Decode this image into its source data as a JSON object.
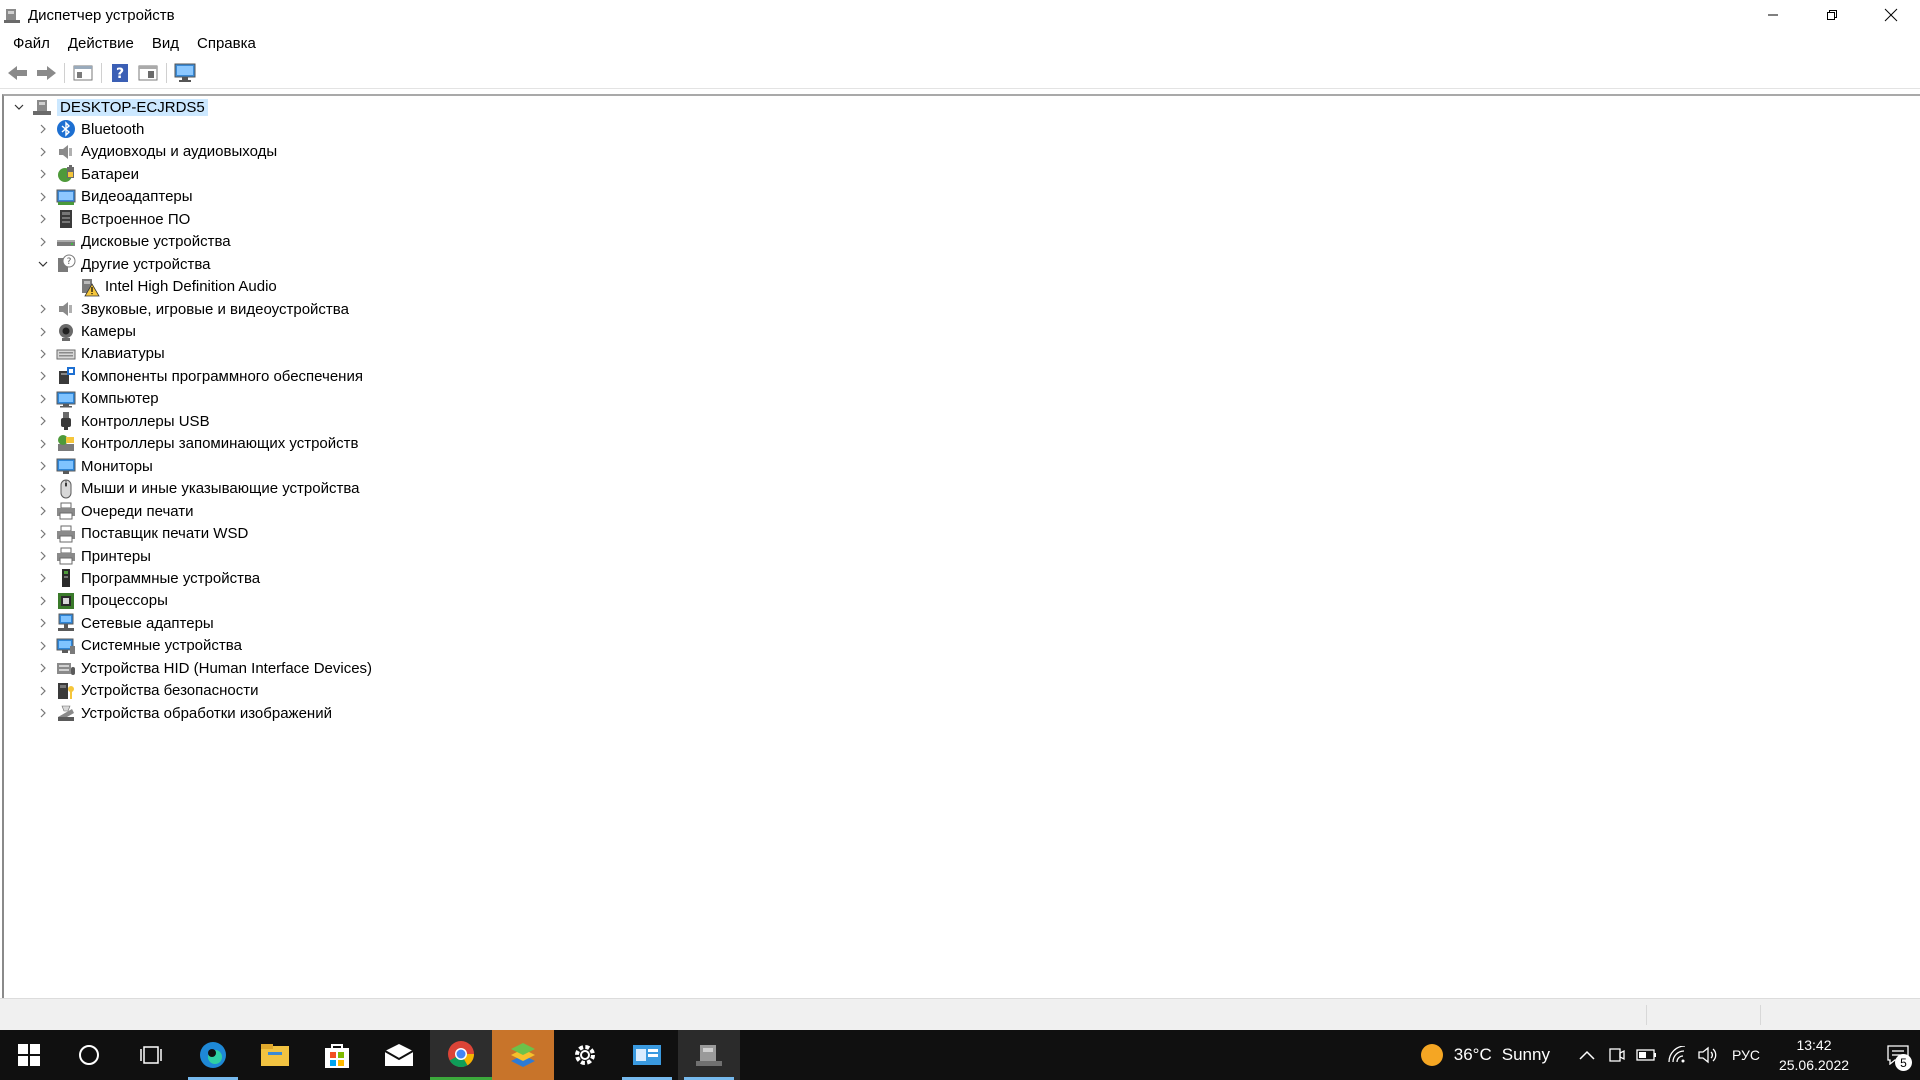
{
  "window": {
    "title": "Диспетчер устройств",
    "icon": "device-manager-icon"
  },
  "menu": [
    "Файл",
    "Действие",
    "Вид",
    "Справка"
  ],
  "toolbar": [
    "back-arrow-icon",
    "forward-arrow-icon",
    "properties-icon",
    "help-icon",
    "update-driver-icon",
    "monitor-scan-icon"
  ],
  "tree": {
    "root": "DESKTOP-ECJRDS5",
    "items": [
      {
        "label": "Bluetooth",
        "icon": "bluetooth-icon",
        "expanded": false
      },
      {
        "label": "Аудиовходы и аудиовыходы",
        "icon": "speaker-icon",
        "expanded": false
      },
      {
        "label": "Батареи",
        "icon": "battery-icon",
        "expanded": false
      },
      {
        "label": "Видеоадаптеры",
        "icon": "display-adapter-icon",
        "expanded": false
      },
      {
        "label": "Встроенное ПО",
        "icon": "firmware-icon",
        "expanded": false
      },
      {
        "label": "Дисковые устройства",
        "icon": "disk-drive-icon",
        "expanded": false
      },
      {
        "label": "Другие устройства",
        "icon": "unknown-device-icon",
        "expanded": true
      },
      {
        "label": "Intel High Definition Audio",
        "icon": "warning-device-icon",
        "child": true
      },
      {
        "label": "Звуковые, игровые и видеоустройства",
        "icon": "speaker-icon",
        "expanded": false
      },
      {
        "label": "Камеры",
        "icon": "camera-icon",
        "expanded": false
      },
      {
        "label": "Клавиатуры",
        "icon": "keyboard-icon",
        "expanded": false
      },
      {
        "label": "Компоненты программного обеспечения",
        "icon": "software-component-icon",
        "expanded": false
      },
      {
        "label": "Компьютер",
        "icon": "computer-icon",
        "expanded": false
      },
      {
        "label": "Контроллеры USB",
        "icon": "usb-icon",
        "expanded": false
      },
      {
        "label": "Контроллеры запоминающих устройств",
        "icon": "storage-controller-icon",
        "expanded": false
      },
      {
        "label": "Мониторы",
        "icon": "monitor-icon",
        "expanded": false
      },
      {
        "label": "Мыши и иные указывающие устройства",
        "icon": "mouse-icon",
        "expanded": false
      },
      {
        "label": "Очереди печати",
        "icon": "printer-icon",
        "expanded": false
      },
      {
        "label": "Поставщик печати WSD",
        "icon": "printer-icon",
        "expanded": false
      },
      {
        "label": "Принтеры",
        "icon": "printer-icon",
        "expanded": false
      },
      {
        "label": "Программные устройства",
        "icon": "software-device-icon",
        "expanded": false
      },
      {
        "label": "Процессоры",
        "icon": "processor-icon",
        "expanded": false
      },
      {
        "label": "Сетевые адаптеры",
        "icon": "network-adapter-icon",
        "expanded": false
      },
      {
        "label": "Системные устройства",
        "icon": "system-device-icon",
        "expanded": false
      },
      {
        "label": "Устройства HID (Human Interface Devices)",
        "icon": "hid-icon",
        "expanded": false
      },
      {
        "label": "Устройства безопасности",
        "icon": "security-device-icon",
        "expanded": false
      },
      {
        "label": "Устройства обработки изображений",
        "icon": "imaging-device-icon",
        "expanded": false
      }
    ]
  },
  "taskbar": {
    "apps": [
      "windows-start-icon",
      "search-circle-icon",
      "task-view-icon",
      "edge-icon",
      "file-explorer-icon",
      "store-icon",
      "mail-icon",
      "chrome-icon",
      "bluestacks-icon",
      "settings-gear-icon",
      "control-panel-icon",
      "device-manager-taskbar-icon"
    ],
    "weather": {
      "temp": "36°C",
      "condition": "Sunny"
    },
    "language": "РУС",
    "time": "13:42",
    "date": "25.06.2022",
    "notifications": "5"
  }
}
